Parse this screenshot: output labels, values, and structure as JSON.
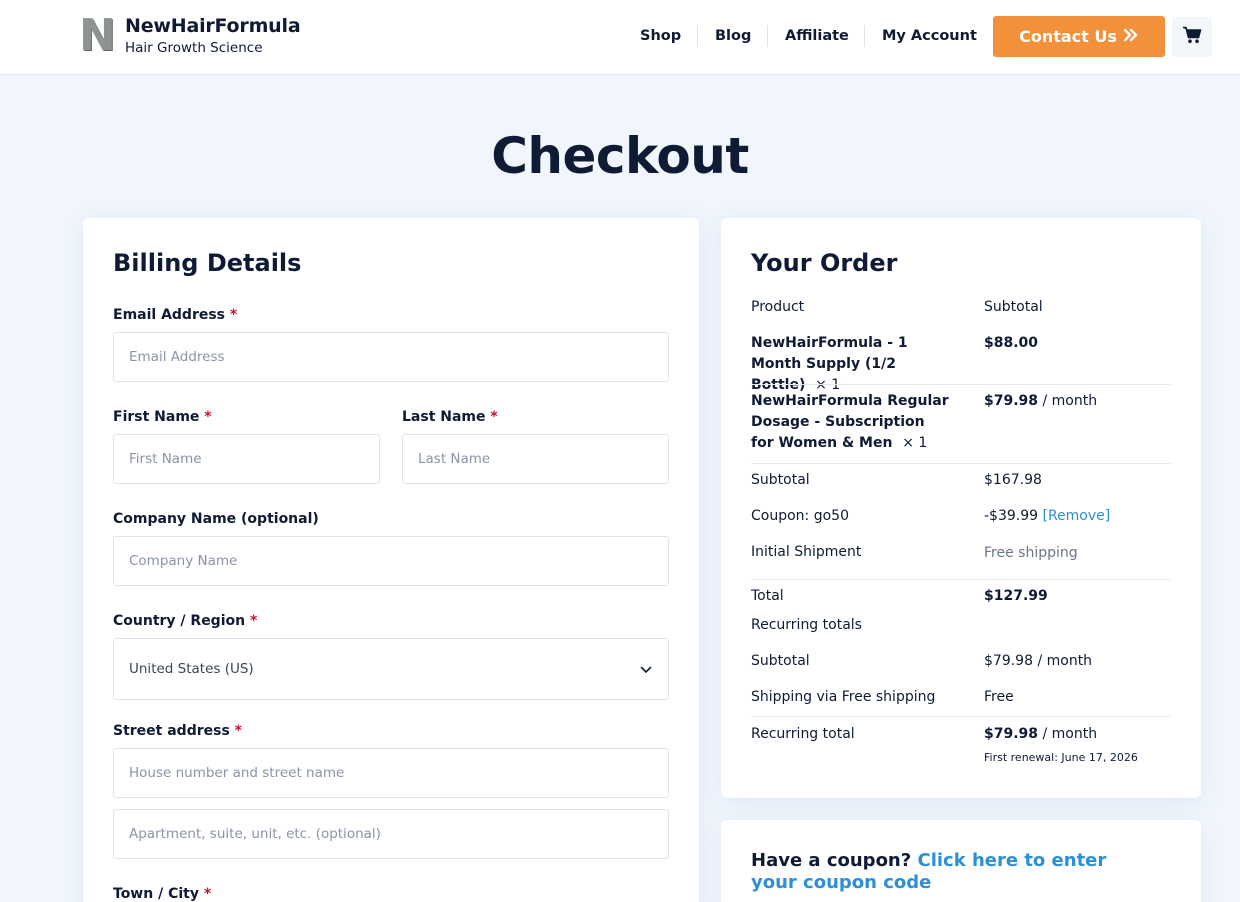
{
  "brand": {
    "logo_letter": "N",
    "name": "NewHairFormula",
    "tagline": "Hair Growth Science"
  },
  "nav": {
    "items": [
      "Shop",
      "Blog",
      "Affiliate",
      "My Account"
    ],
    "contact_label": "Contact Us",
    "contact_icon": "double-chevron-right-icon",
    "cart_icon": "cart-icon"
  },
  "page": {
    "title": "Checkout"
  },
  "billing": {
    "title": "Billing Details",
    "email": {
      "label": "Email Address",
      "required": "*",
      "placeholder": "Email Address",
      "value": ""
    },
    "first_name": {
      "label": "First Name",
      "required": "*",
      "placeholder": "First Name",
      "value": ""
    },
    "last_name": {
      "label": "Last Name",
      "required": "*",
      "placeholder": "Last Name",
      "value": ""
    },
    "company": {
      "label": "Company Name (optional)",
      "placeholder": "Company Name",
      "value": ""
    },
    "country": {
      "label": "Country / Region",
      "required": "*",
      "selected": "United States (US)"
    },
    "street": {
      "label": "Street address",
      "required": "*",
      "placeholder_1": "House number and street name",
      "placeholder_2": "Apartment, suite, unit, etc. (optional)"
    },
    "town": {
      "label": "Town / City",
      "required": "*"
    }
  },
  "order": {
    "title": "Your Order",
    "col_product": "Product",
    "col_subtotal": "Subtotal",
    "items": [
      {
        "name": "NewHairFormula - 1 Month Supply (1/2 Bottle)",
        "qty": "× 1",
        "price": "$88.00"
      },
      {
        "name": "NewHairFormula Regular Dosage - Subscription for Women & Men",
        "qty": "× 1",
        "price": "$79.98",
        "period": "/ month"
      }
    ],
    "subtotal_label": "Subtotal",
    "subtotal_value": "$167.98",
    "coupon_label": "Coupon: go50",
    "coupon_value": "-$39.99",
    "coupon_remove": "[Remove]",
    "shipment_label": "Initial Shipment",
    "shipment_value": "Free shipping",
    "total_label": "Total",
    "total_value": "$127.99",
    "recurring_heading": "Recurring totals",
    "rec_subtotal_label": "Subtotal",
    "rec_subtotal_value": "$79.98",
    "rec_subtotal_period": "/ month",
    "rec_shipping_label": "Shipping via Free shipping",
    "rec_shipping_value": "Free",
    "rec_total_label": "Recurring total",
    "rec_total_value": "$79.98",
    "rec_total_period": "/ month",
    "first_renewal": "First renewal: June 17, 2026"
  },
  "coupon": {
    "prompt": "Have a coupon?",
    "link": "Click here to enter your coupon code"
  },
  "colors": {
    "accent_orange": "#f2913a",
    "navy": "#0f1b35",
    "link_blue": "#2d8fd5",
    "page_bg": "#f1f6fd"
  }
}
